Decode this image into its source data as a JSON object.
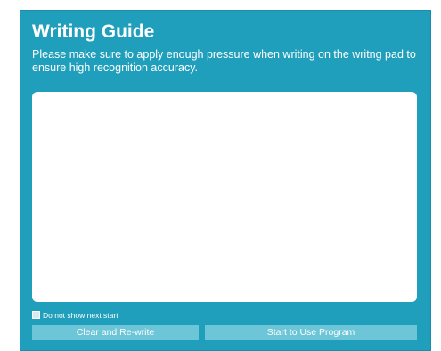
{
  "dialog": {
    "title": "Writing Guide",
    "description": "Please make sure to apply enough pressure when writing on the writng pad to ensure high recognition accuracy."
  },
  "option": {
    "label": "Do not show next start",
    "checked": false
  },
  "buttons": {
    "clear_label": "Clear and Re-write",
    "start_label": "Start to Use Program"
  },
  "colors": {
    "panel_background": "#1f9fbb",
    "button_background": "#6dc5d8",
    "pad_background": "#ffffff"
  }
}
